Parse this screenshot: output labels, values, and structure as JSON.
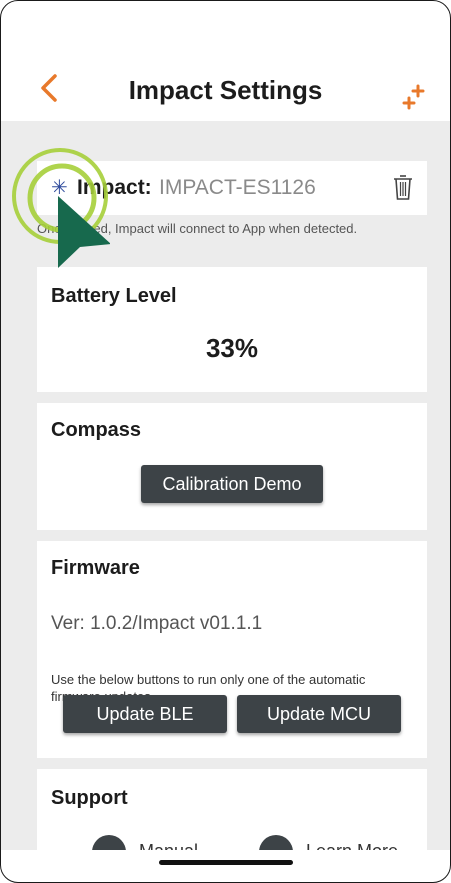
{
  "header": {
    "title": "Impact Settings"
  },
  "device": {
    "label": "Impact:",
    "name": "IMPACT-ES1126",
    "note": "Once paired, Impact will connect to App when detected."
  },
  "battery": {
    "title": "Battery Level",
    "value": "33%"
  },
  "compass": {
    "title": "Compass",
    "button": "Calibration Demo"
  },
  "firmware": {
    "title": "Firmware",
    "version": "Ver: 1.0.2/Impact v01.1.1",
    "note": "Use the below buttons to run only one of the automatic firmware updates.",
    "ble_button": "Update BLE",
    "mcu_button": "Update MCU"
  },
  "support": {
    "title": "Support",
    "manual_label": "Manual",
    "learn_label": "Learn More"
  },
  "colors": {
    "accent": "#e8792b",
    "bluetooth": "#2e4a9c",
    "button": "#3d4347",
    "cursor": "#17694d",
    "ring": "#a6cf3a"
  },
  "icons": {
    "back": "chevron-left-icon",
    "add": "plus-icon",
    "bluetooth": "bluetooth-icon",
    "delete": "trash-icon"
  }
}
